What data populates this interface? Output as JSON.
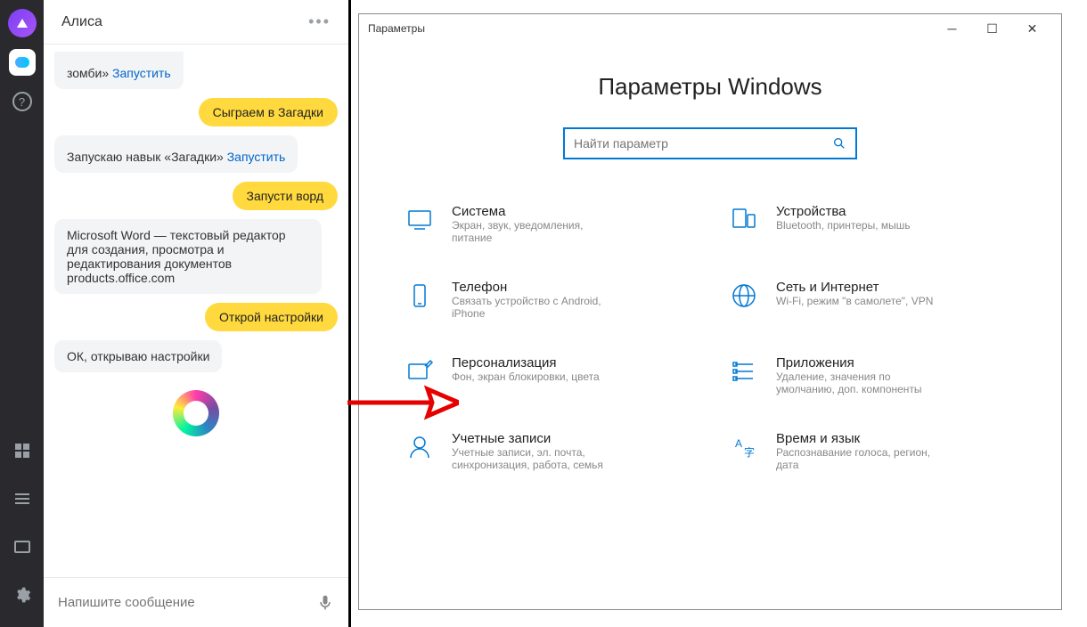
{
  "taskbar": {
    "help_label": "?"
  },
  "chat": {
    "title": "Алиса",
    "more": "•••",
    "messages": [
      {
        "side": "left",
        "text": "зомби»",
        "action": "Запустить"
      },
      {
        "side": "right",
        "text": "Сыграем в Загадки"
      },
      {
        "side": "left",
        "text": "Запускаю навык «Загадки»",
        "action": "Запустить"
      },
      {
        "side": "right",
        "text": "Запусти ворд"
      },
      {
        "side": "left",
        "text": "Microsoft Word — текстовый редактор для создания, просмотра и редактирования документов products.office.com"
      },
      {
        "side": "right",
        "text": "Открой настройки"
      },
      {
        "side": "left",
        "text": "ОК, открываю настройки"
      }
    ],
    "input_placeholder": "Напишите сообщение"
  },
  "settings": {
    "window_title": "Параметры",
    "heading": "Параметры Windows",
    "search_placeholder": "Найти параметр",
    "categories": [
      {
        "title": "Система",
        "desc": "Экран, звук, уведомления, питание"
      },
      {
        "title": "Устройства",
        "desc": "Bluetooth, принтеры, мышь"
      },
      {
        "title": "Телефон",
        "desc": "Связать устройство с Android, iPhone"
      },
      {
        "title": "Сеть и Интернет",
        "desc": "Wi-Fi, режим \"в самолете\", VPN"
      },
      {
        "title": "Персонализация",
        "desc": "Фон, экран блокировки, цвета"
      },
      {
        "title": "Приложения",
        "desc": "Удаление, значения по умолчанию, доп. компоненты"
      },
      {
        "title": "Учетные записи",
        "desc": "Учетные записи, эл. почта, синхронизация, работа, семья"
      },
      {
        "title": "Время и язык",
        "desc": "Распознавание голоса, регион, дата"
      }
    ]
  }
}
